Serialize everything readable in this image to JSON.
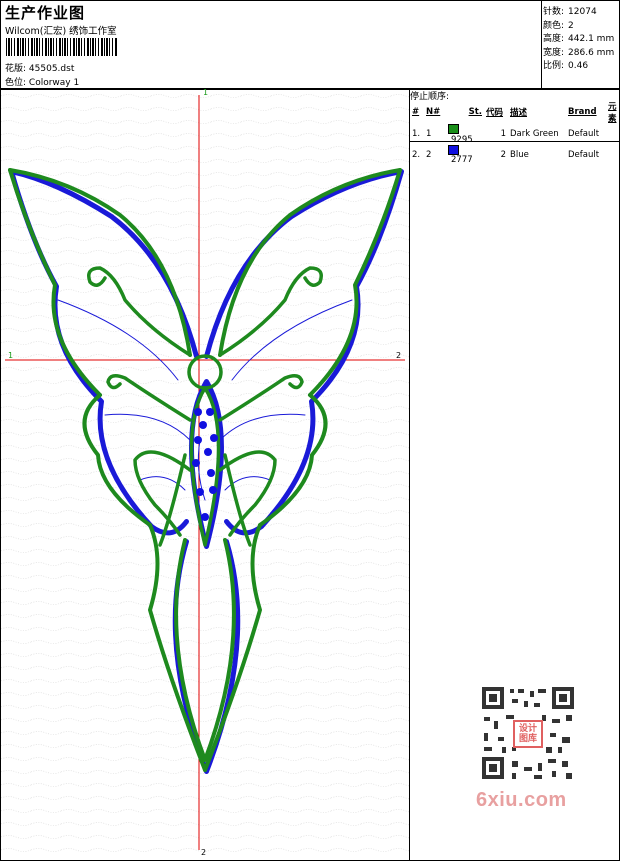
{
  "header": {
    "title": "生产作业图",
    "company": "Wilcom(汇宏) 绣饰工作室",
    "design_label": "花版:",
    "design_value": "45505.dst",
    "colorway_label": "色位:",
    "colorway_value": "Colorway 1"
  },
  "stats": [
    {
      "label": "针数:",
      "value": "12074"
    },
    {
      "label": "颜色:",
      "value": "2"
    },
    {
      "label": "高度:",
      "value": "442.1 mm"
    },
    {
      "label": "宽度:",
      "value": "286.6 mm"
    },
    {
      "label": "比例:",
      "value": "0.46"
    }
  ],
  "stop_sequence": {
    "title": "停止顺序:",
    "columns": [
      "#",
      "N#",
      "St.",
      "代码",
      "描述",
      "Brand",
      "元素"
    ],
    "rows": [
      {
        "num": "1.",
        "n": "1",
        "color": "#1a8f1a",
        "stitches": "9295",
        "code": "1",
        "desc": "Dark Green",
        "brand": "Default"
      },
      {
        "num": "2.",
        "n": "2",
        "color": "#1010e0",
        "stitches": "2777",
        "code": "2",
        "desc": "Blue",
        "brand": "Default"
      }
    ]
  },
  "axis_labels": {
    "top": "1",
    "left": "1",
    "right": "2",
    "bottom": "2"
  },
  "watermark": {
    "qr_badge": "设计图库",
    "site": "6xiu.com"
  }
}
